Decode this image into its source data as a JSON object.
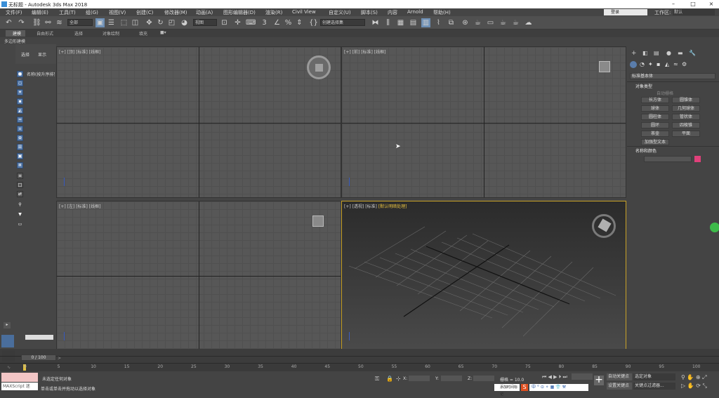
{
  "window": {
    "title": "无标题 - Autodesk 3ds Max 2018"
  },
  "menubar": {
    "items": [
      "文件(F)",
      "编辑(E)",
      "工具(T)",
      "组(G)",
      "视图(V)",
      "创建(C)",
      "修改器(M)",
      "动画(A)",
      "图形编辑器(D)",
      "渲染(R)",
      "Civil View",
      "自定义(U)",
      "脚本(S)",
      "内容",
      "Arnold",
      "帮助(H)"
    ]
  },
  "account": {
    "login": "登录",
    "workspace_label": "工作区:",
    "workspace_value": "默认"
  },
  "toolbar": {
    "selection_filter": "全部",
    "coord_system": "视图",
    "named_selection": "创建选择集"
  },
  "ribbon": {
    "tabs": [
      "建模",
      "自由形式",
      "选择",
      "对象绘制",
      "填充"
    ],
    "sub": "多边形建模"
  },
  "scene_explorer": {
    "tabs": [
      "选择",
      "显示"
    ],
    "sort_header": "名称(按升序排列)"
  },
  "viewports": [
    {
      "label": "[+] [顶] [标准] [线框]"
    },
    {
      "label": "[+] [前] [标准] [线框]"
    },
    {
      "label": "[+] [左] [标准] [线框]"
    },
    {
      "label_a": "[+] [透视] [标准] ",
      "label_b": "[默认明暗处理]"
    }
  ],
  "command_panel": {
    "category": "标准基本体",
    "object_type_title": "对象类型",
    "autogrid": "自动栅格",
    "buttons": [
      "长方体",
      "圆锥体",
      "球体",
      "几何球体",
      "圆柱体",
      "管状体",
      "圆环",
      "四棱锥",
      "茶壶",
      "平面",
      "加强型文本"
    ],
    "name_color_title": "名称和颜色",
    "object_color": "#e0407a"
  },
  "timeline": {
    "frame_display": "0 / 100",
    "ticks": [
      "0",
      "5",
      "10",
      "15",
      "20",
      "25",
      "30",
      "35",
      "40",
      "45",
      "50",
      "55",
      "60",
      "65",
      "70",
      "75",
      "80",
      "85",
      "90",
      "95",
      "100"
    ]
  },
  "status": {
    "maxscript": "MAXScript 迷",
    "message1": "未选定任何对象",
    "message2": "单击或单击并拖动以选择对象",
    "x_label": "X:",
    "y_label": "Y:",
    "z_label": "Z:",
    "grid": "栅格 = 10.0",
    "add_time_tag": "添加时间标记",
    "auto_key": "自动关键点",
    "selected_object": "选定对象",
    "set_key": "设置关键点",
    "key_filters": "关键点过滤器..."
  }
}
